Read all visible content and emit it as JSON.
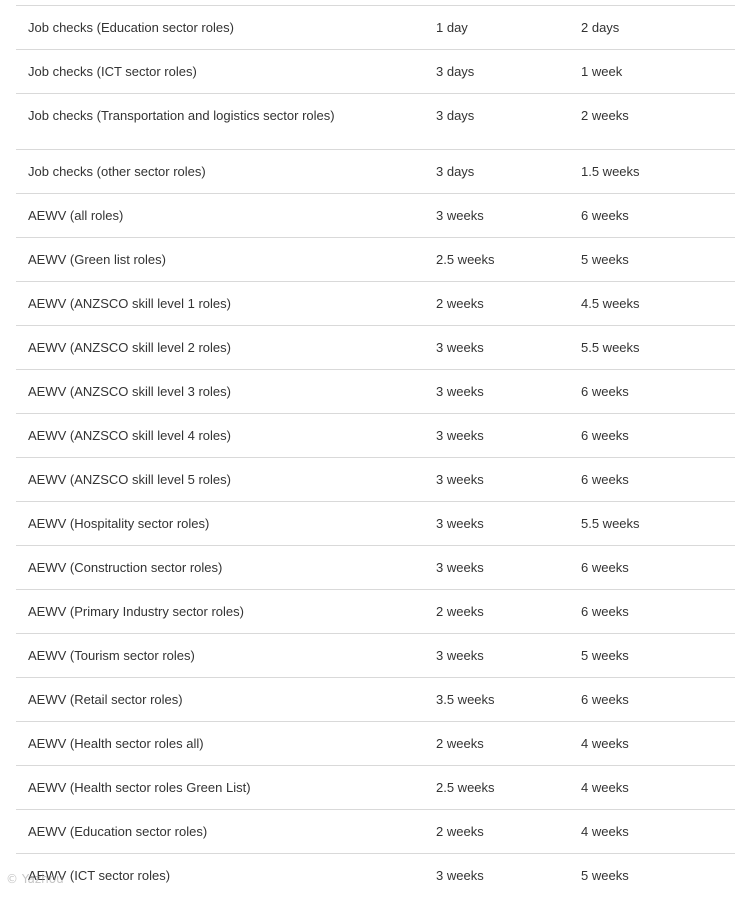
{
  "rows": [
    {
      "role": "Job checks (Education sector roles)",
      "a": "1 day",
      "b": "2 days"
    },
    {
      "role": "Job checks (ICT sector roles)",
      "a": "3 days",
      "b": "1 week"
    },
    {
      "role": "Job checks (Transportation and logistics sector roles)",
      "a": "3 days",
      "b": "2 weeks"
    },
    {
      "role": "Job checks (other sector roles)",
      "a": "3 days",
      "b": "1.5 weeks"
    },
    {
      "role": "AEWV (all roles)",
      "a": "3 weeks",
      "b": "6 weeks"
    },
    {
      "role": "AEWV (Green list roles)",
      "a": "2.5 weeks",
      "b": "5 weeks"
    },
    {
      "role": "AEWV (ANZSCO skill level 1 roles)",
      "a": "2 weeks",
      "b": "4.5 weeks"
    },
    {
      "role": "AEWV (ANZSCO skill level 2 roles)",
      "a": "3 weeks",
      "b": "5.5 weeks"
    },
    {
      "role": "AEWV (ANZSCO skill level 3 roles)",
      "a": "3 weeks",
      "b": "6 weeks"
    },
    {
      "role": "AEWV (ANZSCO skill level 4 roles)",
      "a": "3 weeks",
      "b": "6 weeks"
    },
    {
      "role": "AEWV (ANZSCO skill level 5 roles)",
      "a": "3 weeks",
      "b": "6 weeks"
    },
    {
      "role": "AEWV (Hospitality sector roles)",
      "a": "3 weeks",
      "b": "5.5 weeks"
    },
    {
      "role": "AEWV (Construction sector roles)",
      "a": "3 weeks",
      "b": "6 weeks"
    },
    {
      "role": "AEWV (Primary Industry sector roles)",
      "a": "2 weeks",
      "b": "6 weeks"
    },
    {
      "role": "AEWV (Tourism sector roles)",
      "a": "3 weeks",
      "b": "5 weeks"
    },
    {
      "role": "AEWV (Retail sector roles)",
      "a": "3.5 weeks",
      "b": "6 weeks"
    },
    {
      "role": "AEWV (Health sector roles all)",
      "a": "2 weeks",
      "b": "4 weeks"
    },
    {
      "role": "AEWV (Health sector roles Green List)",
      "a": "2.5 weeks",
      "b": "4 weeks"
    },
    {
      "role": "AEWV (Education sector roles)",
      "a": "2 weeks",
      "b": "4 weeks"
    },
    {
      "role": "AEWV (ICT sector roles)",
      "a": "3 weeks",
      "b": "5 weeks"
    }
  ],
  "watermark": "© Yazhou"
}
